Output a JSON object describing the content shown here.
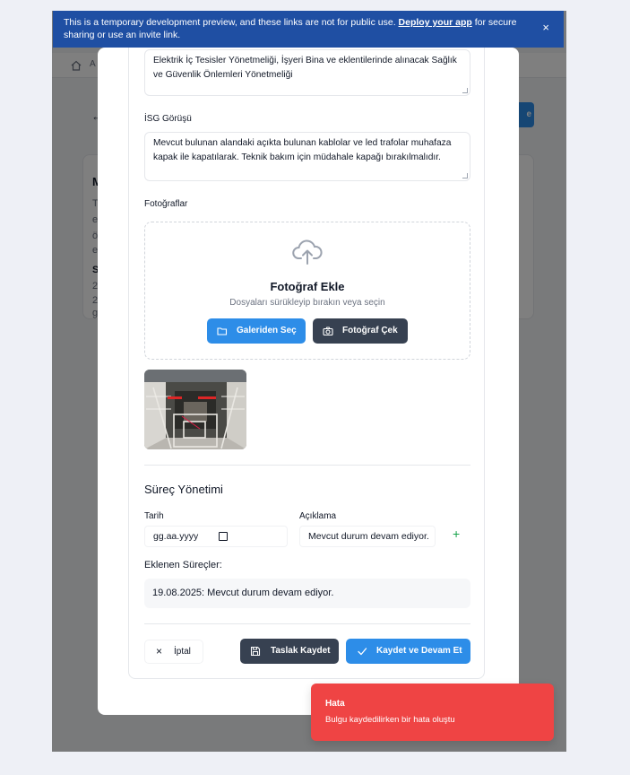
{
  "banner": {
    "text": "This is a temporary development preview, and these links are not for public use.",
    "link": "Deploy your app",
    "text_after": "for secure sharing or use an invite link.",
    "close": "×"
  },
  "background": {
    "breadcrumb": "A",
    "back_arrow": "←",
    "button_label": "e",
    "card_lines": [
      "M",
      "T",
      "e",
      "ö",
      "e",
      "S",
      "2",
      "2",
      "g"
    ]
  },
  "form": {
    "regulation_text": "Elektrik İç Tesisler Yönetmeliği, İşyeri Bina ve eklentilerinde alınacak Sağlık ve Güvenlik Önlemleri Yönetmeliği",
    "isg_label": "İSG Görüşü",
    "isg_text": "Mevcut bulunan alandaki açıkta bulunan kablolar ve led trafolar muhafaza kapak ile kapatılarak. Teknik bakım için müdahale kapağı bırakılmalıdır.",
    "photos_label": "Fotoğraflar",
    "upload": {
      "title": "Fotoğraf Ekle",
      "subtitle": "Dosyaları sürükleyip bırakın veya seçin",
      "gallery_button": "Galeriden Seç",
      "camera_button": "Fotoğraf Çek"
    },
    "process": {
      "title": "Süreç Yönetimi",
      "date_label": "Tarih",
      "date_placeholder": "gg.aa.yyyy",
      "desc_label": "Açıklama",
      "desc_value": "Mevcut durum devam ediyor.",
      "add_icon": "+",
      "added_label": "Eklenen Süreçler:",
      "items": [
        "19.08.2025: Mevcut durum devam ediyor."
      ]
    },
    "actions": {
      "cancel": "İptal",
      "cancel_icon": "×",
      "draft": "Taslak Kaydet",
      "save": "Kaydet ve Devam Et"
    }
  },
  "toast": {
    "title": "Hata",
    "message": "Bulgu kaydedilirken bir hata oluştu"
  },
  "colors": {
    "primary": "#2d8de8",
    "dark": "#374151",
    "error": "#ef4444",
    "banner": "#1f4fa3"
  }
}
